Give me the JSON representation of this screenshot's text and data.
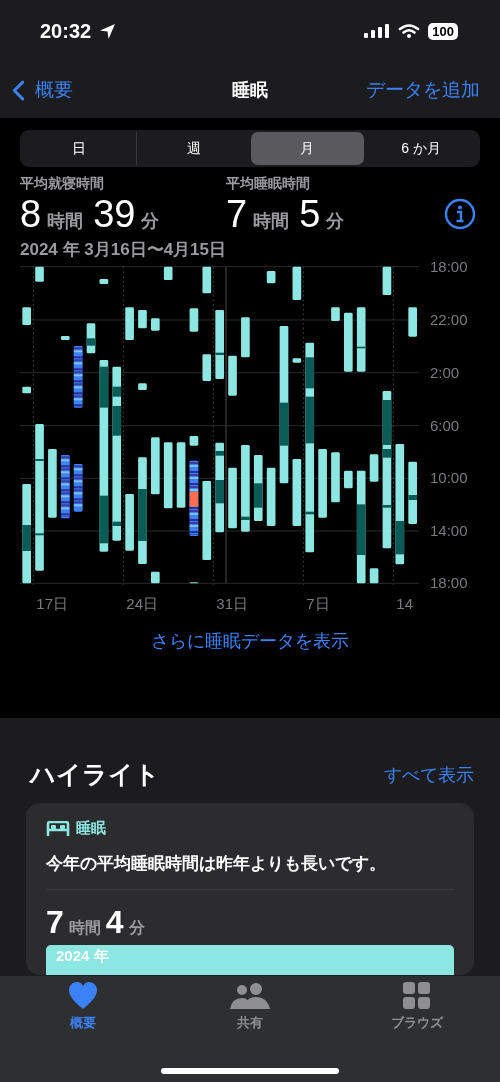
{
  "status_bar": {
    "time": "20:32",
    "battery": "100"
  },
  "nav": {
    "back": "概要",
    "title": "睡眠",
    "action": "データを追加"
  },
  "segments": [
    {
      "label": "日",
      "selected": false
    },
    {
      "label": "週",
      "selected": false
    },
    {
      "label": "月",
      "selected": true
    },
    {
      "label": "6 か月",
      "selected": false
    }
  ],
  "stats": [
    {
      "label": "平均就寝時間",
      "hours": "8",
      "hours_unit": "時間",
      "minutes": "39",
      "minutes_unit": "分"
    },
    {
      "label": "平均睡眠時間",
      "hours": "7",
      "hours_unit": "時間",
      "minutes": "5",
      "minutes_unit": "分"
    }
  ],
  "date_range": "2024 年 3月16日〜4月15日",
  "chart": {
    "y_labels": [
      "18:00",
      "22:00",
      "2:00",
      "6:00",
      "10:00",
      "14:00",
      "18:00"
    ],
    "x_labels": [
      "17日",
      "24日",
      "31日",
      "7日",
      "14"
    ]
  },
  "more_link": "さらに睡眠データを表示",
  "highlights": {
    "title": "ハイライト",
    "see_all": "すべて表示",
    "card": {
      "category": "睡眠",
      "message": "今年の平均睡眠時間は昨年よりも長いです。",
      "hours": "7",
      "hours_unit": "時間",
      "minutes": "4",
      "minutes_unit": "分",
      "bar_label": "2024 年"
    }
  },
  "tab_bar": [
    {
      "label": "概要",
      "kind": "heart",
      "selected": true
    },
    {
      "label": "共有",
      "kind": "people",
      "selected": false
    },
    {
      "label": "ブラウズ",
      "kind": "grid",
      "selected": false
    }
  ]
}
